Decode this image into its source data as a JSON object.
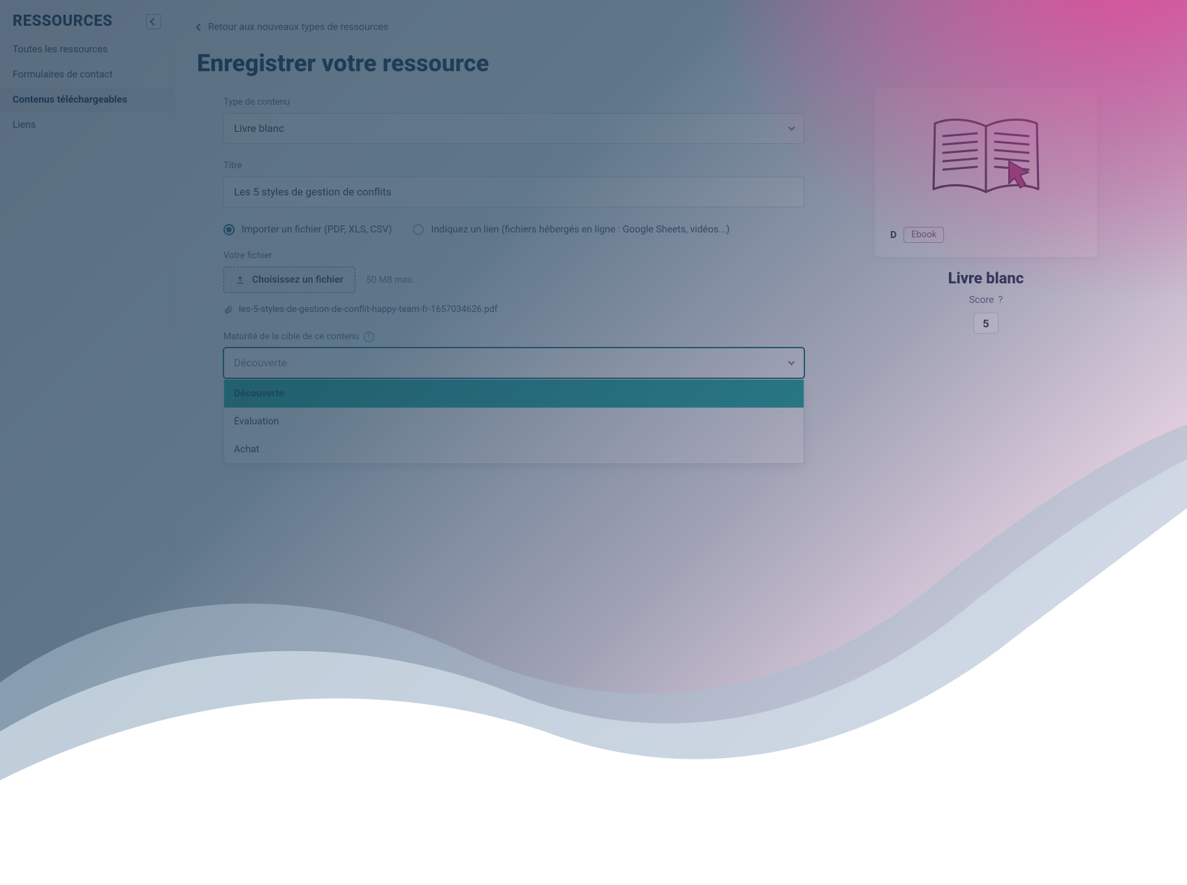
{
  "sidebar": {
    "title": "RESSOURCES",
    "items": [
      {
        "label": "Toutes les ressources",
        "active": false
      },
      {
        "label": "Formulaires de contact",
        "active": false
      },
      {
        "label": "Contenus téléchargeables",
        "active": true
      },
      {
        "label": "Liens",
        "active": false
      }
    ]
  },
  "header": {
    "back_label": "Retour aux nouveaux types de ressources",
    "page_title": "Enregistrer votre ressource"
  },
  "form": {
    "content_type": {
      "label": "Type de contenu",
      "value": "Livre blanc"
    },
    "title": {
      "label": "Titre",
      "value": "Les 5 styles de gestion de conflits"
    },
    "source": {
      "option_import": "Importer un fichier (PDF, XLS, CSV)",
      "option_link": "Indiquez un lien (fichiers hébergés en ligne : Google Sheets, vidéos...)",
      "selected": "import"
    },
    "file": {
      "label": "Votre fichier",
      "button": "Choisissez un fichier",
      "note": "50 MB max.",
      "attached_name": "les-5-styles-de-gestion-de-conflit-happy-team-fr-1657034626.pdf"
    },
    "maturity": {
      "label": "Maturité de la cible de ce contenu",
      "placeholder": "Découverte",
      "options": [
        {
          "label": "Découverte",
          "highlight": true
        },
        {
          "label": "Évaluation",
          "highlight": false
        },
        {
          "label": "Achat",
          "highlight": false
        }
      ]
    }
  },
  "preview": {
    "tag_letter": "D",
    "tag_pill": "Ebook",
    "title": "Livre blanc",
    "score_label": "Score",
    "score_value": "5"
  },
  "colors": {
    "teal": "#1aa9a0",
    "pink": "#e8408f",
    "navy": "#123552"
  }
}
